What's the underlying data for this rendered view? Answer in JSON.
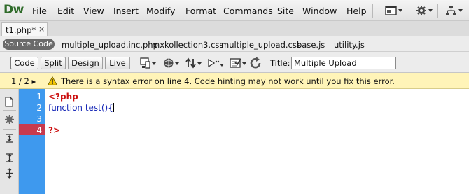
{
  "app": {
    "logo": "Dw"
  },
  "menu": [
    "File",
    "Edit",
    "View",
    "Insert",
    "Modify",
    "Format",
    "Commands",
    "Site",
    "Window",
    "Help"
  ],
  "toolbar_icons": [
    "layout-icon",
    "gear-icon",
    "sitemap-icon"
  ],
  "document_tab": {
    "label": "t1.php*",
    "close": "×"
  },
  "related_files": {
    "source_label": "Source Code",
    "files": [
      "multiple_upload.inc.php",
      "mxkollection3.css",
      "multiple_upload.css",
      "base.js",
      "utility.js"
    ]
  },
  "view_buttons": [
    "Code",
    "Split",
    "Design",
    "Live"
  ],
  "doc_toolbar_icons": [
    "multiscreen-icon",
    "preview-browser-icon",
    "file-management-icon",
    "inspect-icon",
    "validate-icon",
    "refresh-icon"
  ],
  "title_field": {
    "label": "Title:",
    "value": "Multiple Upload"
  },
  "error_bar": {
    "nav": "1 / 2 ▸",
    "message": "There is a syntax error on line 4.  Code hinting may not work until you fix this error."
  },
  "code": {
    "line_numbers": [
      "1",
      "2",
      "3",
      "4"
    ],
    "lines": [
      "<?php",
      "function test(){",
      "",
      "?>"
    ],
    "error_line": "4"
  }
}
